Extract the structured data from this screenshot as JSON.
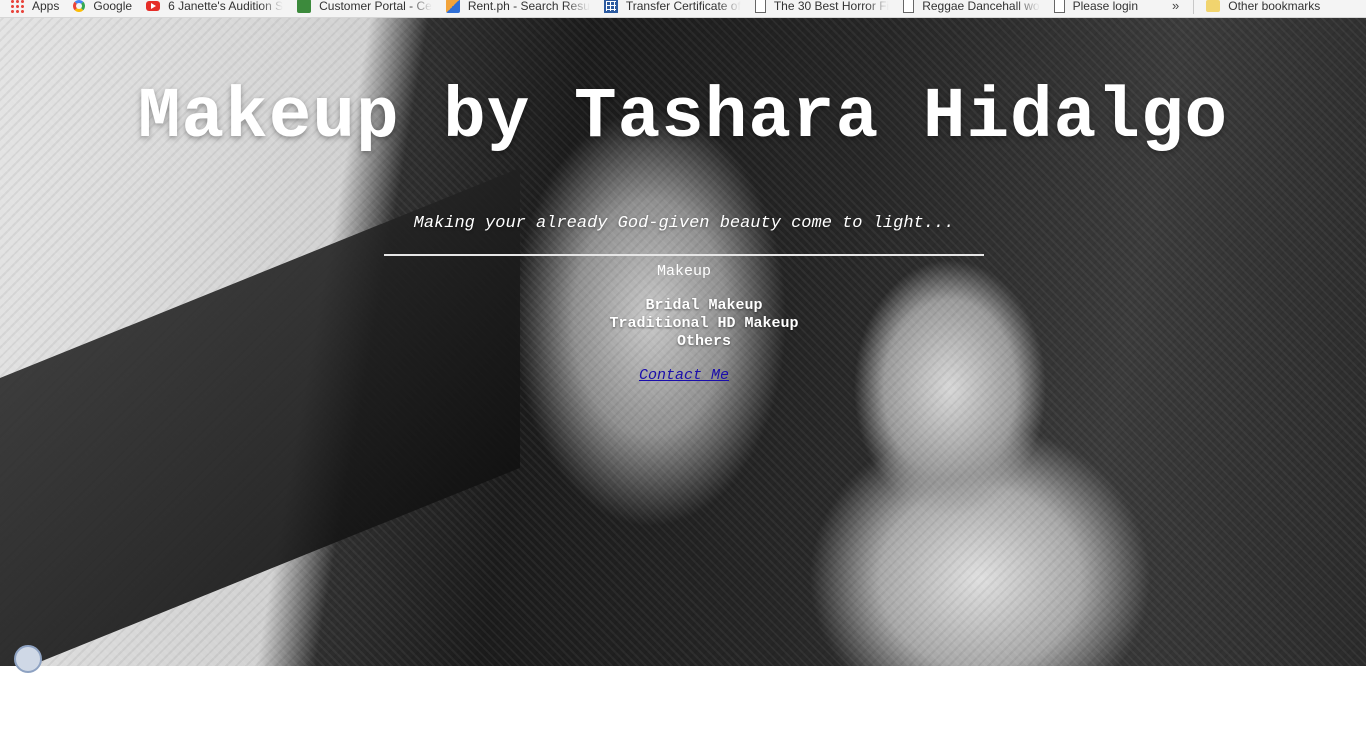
{
  "bookmarks": [
    {
      "label": "Apps",
      "icon": "apps-grid-icon"
    },
    {
      "label": "Google",
      "icon": "google-icon"
    },
    {
      "label": "6 Janette's Audition S",
      "icon": "youtube-icon"
    },
    {
      "label": "Customer Portal - Ce",
      "icon": "portal-icon"
    },
    {
      "label": "Rent.ph - Search Resu",
      "icon": "rent-icon"
    },
    {
      "label": "Transfer Certificate of",
      "icon": "spreadsheet-icon"
    },
    {
      "label": "The 30 Best Horror Fi",
      "icon": "page-icon"
    },
    {
      "label": "Reggae Dancehall wo",
      "icon": "page-icon"
    },
    {
      "label": "Please login",
      "icon": "page-icon"
    }
  ],
  "bookmarks_more": "»",
  "other_bookmarks": "Other bookmarks",
  "hero": {
    "title": "Makeup by Tashara Hidalgo",
    "tagline": "Making your already God-given beauty come to light...",
    "nav_label": "Makeup",
    "services": [
      "Bridal Makeup",
      "Traditional HD Makeup",
      "Others"
    ],
    "contact_label": "Contact Me"
  }
}
